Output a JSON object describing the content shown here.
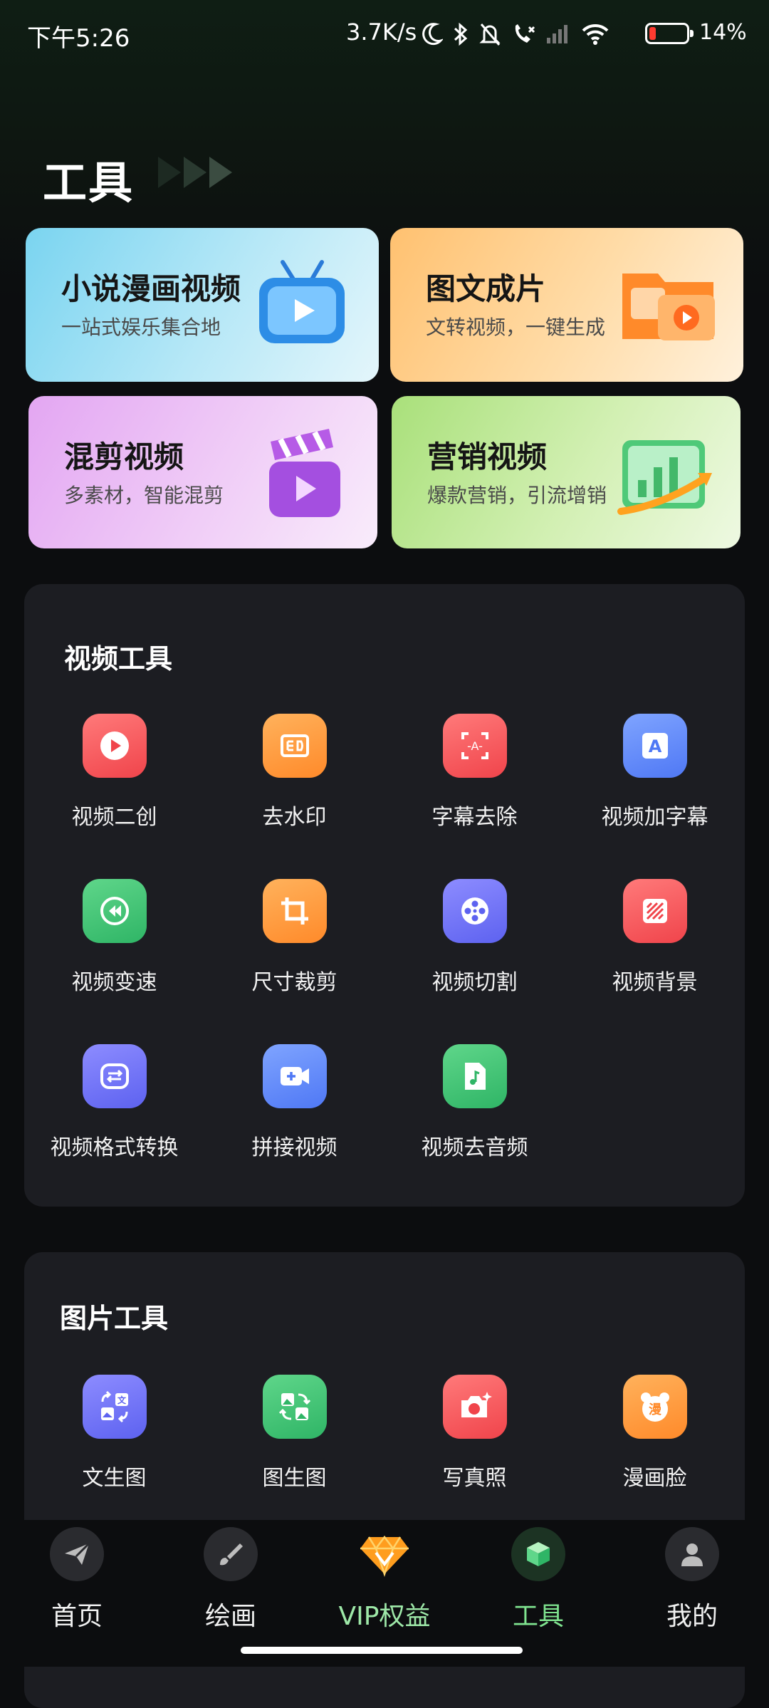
{
  "status_bar": {
    "time": "下午5:26",
    "network_speed": "3.7K/s",
    "battery_percent": "14%",
    "icons": [
      "moon-icon",
      "bluetooth-icon",
      "bell-off-icon",
      "call-icon",
      "signal-icon",
      "wifi-icon",
      "battery-icon"
    ]
  },
  "header": {
    "title": "工具"
  },
  "feature_cards": [
    {
      "title": "小说漫画视频",
      "subtitle": "一站式娱乐集合地",
      "icon": "tv-icon"
    },
    {
      "title": "图文成片",
      "subtitle": "文转视频，一键生成",
      "icon": "folder-video-icon"
    },
    {
      "title": "混剪视频",
      "subtitle": "多素材，智能混剪",
      "icon": "clapperboard-icon"
    },
    {
      "title": "营销视频",
      "subtitle": "爆款营销，引流增销",
      "icon": "chart-growth-icon"
    }
  ],
  "video_tools": {
    "title": "视频工具",
    "items": [
      {
        "label": "视频二创",
        "icon": "play-icon",
        "color": "#f0444b"
      },
      {
        "label": "去水印",
        "icon": "watermark-icon",
        "color": "#ff8a2a"
      },
      {
        "label": "字幕去除",
        "icon": "subtitle-remove-icon",
        "color": "#f0444b"
      },
      {
        "label": "视频加字幕",
        "icon": "text-a-icon",
        "color": "#4f78f5"
      },
      {
        "label": "视频变速",
        "icon": "speed-icon",
        "color": "#2fb566"
      },
      {
        "label": "尺寸裁剪",
        "icon": "crop-icon",
        "color": "#ff8a2a"
      },
      {
        "label": "视频切割",
        "icon": "film-reel-icon",
        "color": "#5d62f0"
      },
      {
        "label": "视频背景",
        "icon": "background-icon",
        "color": "#f0444b"
      },
      {
        "label": "视频格式转换",
        "icon": "convert-icon",
        "color": "#5d62f0"
      },
      {
        "label": "拼接视频",
        "icon": "video-add-icon",
        "color": "#4f78f5"
      },
      {
        "label": "视频去音频",
        "icon": "music-file-icon",
        "color": "#2fb566"
      }
    ]
  },
  "image_tools": {
    "title": "图片工具",
    "items": [
      {
        "label": "文生图",
        "icon": "text-to-image-icon",
        "color": "#5d62f0"
      },
      {
        "label": "图生图",
        "icon": "image-to-image-icon",
        "color": "#2fb566"
      },
      {
        "label": "写真照",
        "icon": "camera-sparkle-icon",
        "color": "#f0444b"
      },
      {
        "label": "漫画脸",
        "icon": "bear-face-icon",
        "color": "#ff8a2a"
      }
    ]
  },
  "bottom_nav": {
    "items": [
      {
        "label": "首页",
        "icon": "paper-plane-icon",
        "active": false
      },
      {
        "label": "绘画",
        "icon": "brush-icon",
        "active": false
      },
      {
        "label": "VIP权益",
        "icon": "vip-diamond-icon",
        "active": false
      },
      {
        "label": "工具",
        "icon": "cube-icon",
        "active": true
      },
      {
        "label": "我的",
        "icon": "person-icon",
        "active": false
      }
    ]
  }
}
